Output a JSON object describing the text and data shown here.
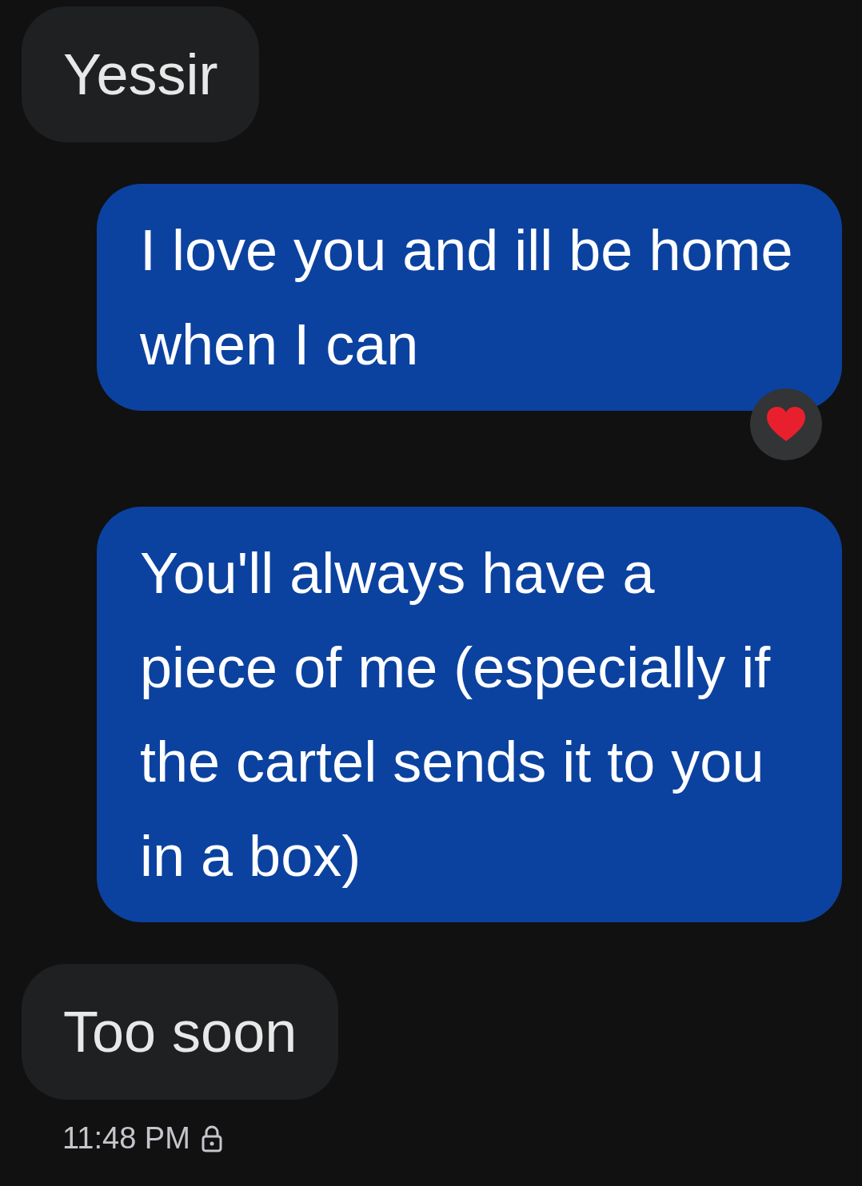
{
  "messages": [
    {
      "kind": "incoming",
      "text": "Yessir",
      "reacted": false
    },
    {
      "kind": "outgoing",
      "text": "I love you and ill be home when I can",
      "reacted": true
    },
    {
      "kind": "outgoing",
      "text": "You'll always have a piece of me (especially if the cartel sends it to you in a box)",
      "reacted": false
    },
    {
      "kind": "incoming",
      "text": "Too soon",
      "reacted": false
    }
  ],
  "timestamp": {
    "time": "11:48 PM",
    "locked": true
  }
}
